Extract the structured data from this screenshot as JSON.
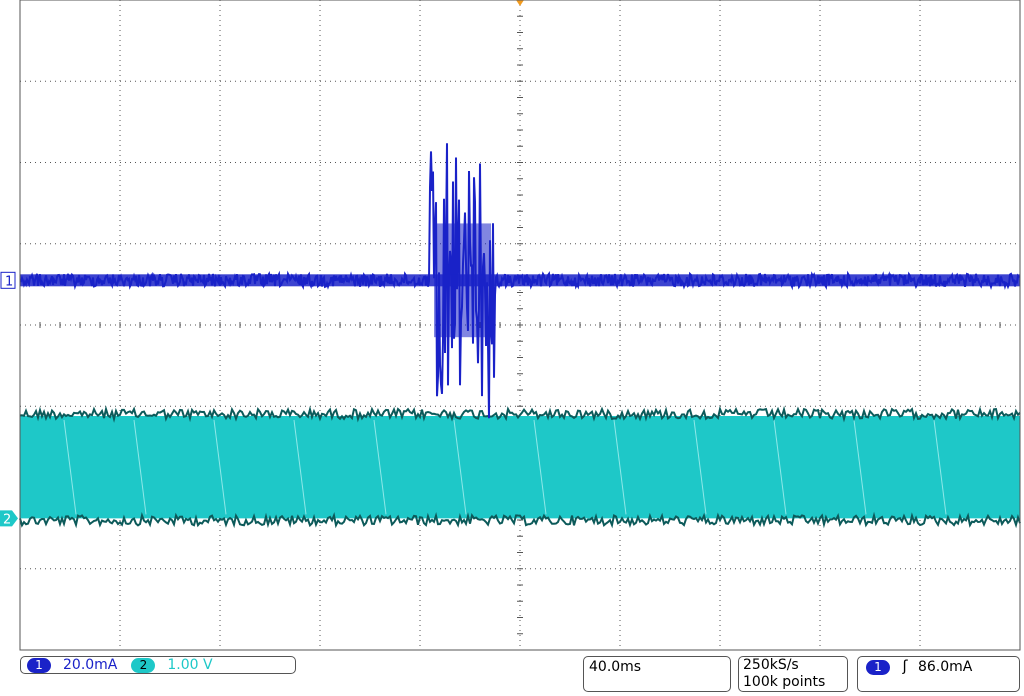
{
  "colors": {
    "ch1": "#1a22c8",
    "ch2": "#1ec8c8",
    "ch2_edge": "#0c5a5a",
    "grid": "#555555",
    "trigger_marker": "#f29b1f"
  },
  "chart_data": {
    "type": "line",
    "title": "",
    "xlabel": "",
    "ylabel": "",
    "grid": true,
    "divisions": {
      "horizontal": 10,
      "vertical": 8
    },
    "series": [
      {
        "channel": 1,
        "marker_label": "1",
        "color": "#1a22c8",
        "baseline_div": 0.55,
        "noise_div": 0.08,
        "burst_start_div": 4.1,
        "burst_end_div": 4.75,
        "burst_amplitude_div": 2.0
      },
      {
        "channel": 2,
        "marker_label": "2",
        "color": "#1ec8c8",
        "low_div": -2.38,
        "high_div": -1.12,
        "wide_stripe_positions_div": [
          0.5,
          1.2,
          2.0,
          2.8,
          3.6,
          4.4,
          5.2,
          6.0,
          6.8,
          7.6,
          8.4,
          9.2
        ]
      }
    ]
  },
  "status": {
    "ch1_num": "1",
    "ch1_scale": "20.0mA",
    "ch2_num": "2",
    "ch2_scale": "1.00 V",
    "timebase": "40.0ms",
    "sample_rate": "250kS/s",
    "record_length": "100k points",
    "trigger_channel": "1",
    "trigger_slope_icon": "rising-edge-icon",
    "trigger_slope_glyph": "ʃ",
    "trigger_level": "86.0mA"
  }
}
